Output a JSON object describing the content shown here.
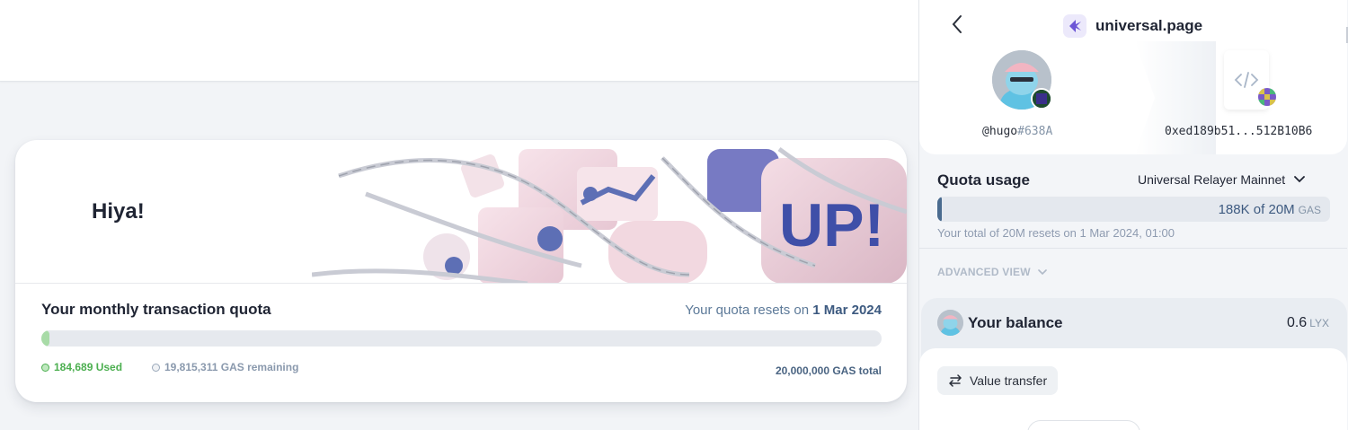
{
  "page": {
    "hero_title": "Hiya!",
    "quota": {
      "title": "Your monthly transaction quota",
      "reset_prefix": "Your quota resets on",
      "reset_date": "1 Mar 2024",
      "used_fraction": 0.0092,
      "used_label": "184,689 Used",
      "remaining_label": "19,815,311 GAS remaining",
      "total_label": "20,000,000 GAS total"
    }
  },
  "panel": {
    "site_name": "universal.page",
    "profile": {
      "name": "@hugo",
      "tag": "#638A"
    },
    "contract": {
      "address": "0xed189b51...512B10B6"
    },
    "quota_usage": {
      "title": "Quota usage",
      "network": "Universal Relayer Mainnet",
      "value": "188K of 20M",
      "unit": "GAS",
      "used_fraction": 0.0094,
      "note": "Your total of 20M resets on 1 Mar 2024, 01:00"
    },
    "advanced_view": "ADVANCED VIEW",
    "balance": {
      "title": "Your balance",
      "value": "0.6",
      "unit": "LYX"
    },
    "transaction_type": "Value transfer"
  },
  "colors": {
    "accent": "#3d5a80",
    "used_green": "#4caf50",
    "brand_purple": "#6c55d6"
  },
  "icons": [
    "back-chevron-icon",
    "universal-page-logo-icon",
    "chevron-down-icon",
    "code-icon",
    "transfer-arrows-icon"
  ]
}
